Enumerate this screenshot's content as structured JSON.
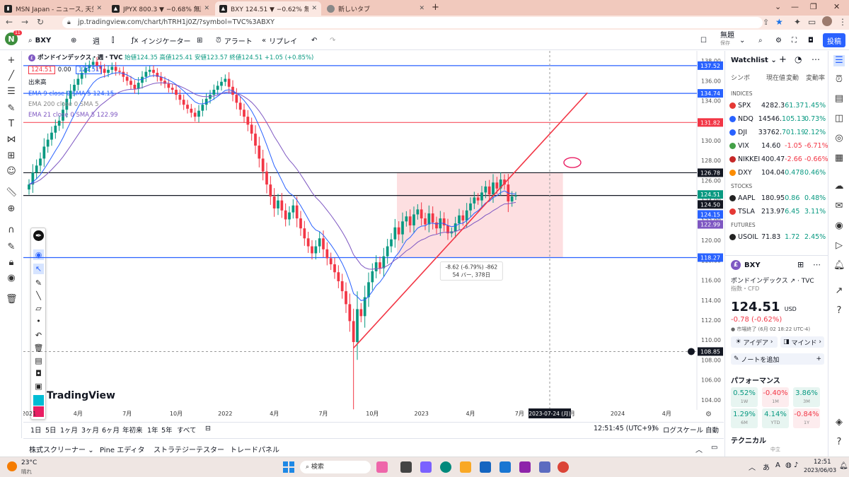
{
  "browser": {
    "tabs": [
      {
        "title": "MSN Japan - ニュース, 天気, メール",
        "color": "#222"
      },
      {
        "title": "JPYX 800.3 ▼ −0.68% 無題",
        "color": "#222"
      },
      {
        "title": "BXY 124.51 ▼ −0.62% 無題",
        "color": "#222",
        "active": true
      },
      {
        "title": "新しいタブ",
        "color": "#666"
      }
    ],
    "url": "jp.tradingview.com/chart/hTRH1j0Z/?symbol=TVC%3ABXY"
  },
  "topbar": {
    "avatar_letter": "N",
    "avatar_badge": "11",
    "symbol": "BXY",
    "interval": "週",
    "indicators": "インジケーター",
    "alerts": "アラート",
    "replay": "リプレイ",
    "layout_name": "無題",
    "layout_sub": "保存",
    "publish": "投稿"
  },
  "legend": {
    "name": "ポンドインデックス・週・TVC",
    "ohlc": "始値124.35 高値125.41 安値123.57 終値124.51 +1.05 (+0.85%)",
    "price_box_1": "124.51",
    "spread": "0.00",
    "price_box_2": "124.51",
    "volume": "出来高",
    "ema9": "EMA 9 close 0 SMA 5  124.15",
    "ema200": "EMA 200 close 0 SMA 5",
    "ema21": "EMA 21 close 0 SMA 5    122.99"
  },
  "chart_data": {
    "type": "candlestick",
    "symbol": "BXY",
    "exchange": "TVC",
    "timeframe": "週",
    "y_ticks": [
      104,
      106,
      108,
      110,
      112,
      114,
      116,
      118,
      120,
      122,
      124,
      126,
      128,
      130,
      132,
      134,
      136,
      138
    ],
    "ylim": [
      103,
      139
    ],
    "x_ticks": [
      "2021",
      "4月",
      "7月",
      "10月",
      "2022",
      "4月",
      "7月",
      "10月",
      "2023",
      "4月",
      "7月",
      "10月",
      "2024",
      "4月"
    ],
    "x_tick_index": [
      0,
      13,
      26,
      39,
      52,
      65,
      78,
      91,
      104,
      117,
      130,
      143,
      156,
      169
    ],
    "x_range": [
      -1.5,
      177
    ],
    "close": [
      125.6,
      126.8,
      127.5,
      128.2,
      129.4,
      130.1,
      130.8,
      131.5,
      132.0,
      133.1,
      134.2,
      135.0,
      135.6,
      136.2,
      136.8,
      137.3,
      137.6,
      137.9,
      137.5,
      137.2,
      136.8,
      137.1,
      137.4,
      137.0,
      136.9,
      136.4,
      136.0,
      135.6,
      135.2,
      135.8,
      136.4,
      136.9,
      137.1,
      136.8,
      136.4,
      136.0,
      135.7,
      135.3,
      135.1,
      134.6,
      134.1,
      133.6,
      133.2,
      132.8,
      132.4,
      133.0,
      133.6,
      134.2,
      134.6,
      135.1,
      135.5,
      135.9,
      136.2,
      135.4,
      134.6,
      133.8,
      133.1,
      132.4,
      131.6,
      130.7,
      129.5,
      128.2,
      126.9,
      125.6,
      124.4,
      123.2,
      124.0,
      123.0,
      122.1,
      122.8,
      123.5,
      122.2,
      121.2,
      120.2,
      119.4,
      118.7,
      119.4,
      120.2,
      119.1,
      118.2,
      117.6,
      116.8,
      115.9,
      114.9,
      113.6,
      111.9,
      109.8,
      113.1,
      112.4,
      114.3,
      115.8,
      116.9,
      117.8,
      117.2,
      118.4,
      119.4,
      120.1,
      121.3,
      120.6,
      121.9,
      122.4,
      121.5,
      122.6,
      123.1,
      122.2,
      121.6,
      122.7,
      121.8,
      121.2,
      122.2,
      121.5,
      120.7,
      120.9,
      121.7,
      122.5,
      122.0,
      123.0,
      123.7,
      124.3,
      124.0,
      124.8,
      125.4,
      124.6,
      125.8,
      125.2,
      126.1,
      125.6,
      123.9,
      124.4,
      124.51
    ],
    "ema_fast_last": 124.15,
    "ema_slow_last": 122.99,
    "horizontal_lines": [
      {
        "price": 137.52,
        "color": "#2962ff"
      },
      {
        "price": 134.74,
        "color": "#2962ff"
      },
      {
        "price": 131.82,
        "color": "#f7525f"
      },
      {
        "price": 126.78,
        "color": "#131722"
      },
      {
        "price": 124.5,
        "color": "#131722"
      },
      {
        "price": 118.27,
        "color": "#2962ff"
      }
    ],
    "price_labels": [
      {
        "text": "137.52",
        "price": 137.52,
        "bg": "#2962ff"
      },
      {
        "text": "134.74",
        "price": 134.74,
        "bg": "#2962ff"
      },
      {
        "text": "131.82",
        "price": 131.82,
        "bg": "#f23645"
      },
      {
        "text": "126.78",
        "price": 126.78,
        "bg": "#131722"
      },
      {
        "text": "124.51",
        "price": 124.6,
        "bg": "#089981"
      },
      {
        "text": "124.50",
        "price": 123.6,
        "bg": "#131722"
      },
      {
        "text": "124.15",
        "price": 122.6,
        "bg": "#2962ff"
      },
      {
        "text": "122.99",
        "price": 121.6,
        "bg": "#7e57c2"
      },
      {
        "text": "118.27",
        "price": 118.27,
        "bg": "#2962ff"
      },
      {
        "text": "108.85",
        "price": 108.85,
        "bg": "#131722"
      }
    ],
    "measure": {
      "line1": "-8.62 (-6.79%) -862",
      "line2": "54 バー, 378日",
      "x_from": 97.5,
      "x_to": 141.5,
      "price_top": 126.78,
      "price_bottom": 118.27
    },
    "trendline": {
      "x1": 86,
      "y1": 109.2,
      "x2": 148,
      "y2": 134.8
    },
    "crosshair": {
      "price": 108.85,
      "date_label": "2023-07-24 (月)",
      "index": 138
    },
    "watermark": "TradingView"
  },
  "rangebar": {
    "ranges": [
      "1日",
      "5日",
      "1ヶ月",
      "3ヶ月",
      "6ヶ月",
      "年初来",
      "1年",
      "5年",
      "すべて"
    ],
    "time": "12:51:45 (UTC+9)",
    "pct": "%",
    "log": "ログスケール",
    "auto": "自動"
  },
  "bottompanel": {
    "tabs": [
      "株式スクリーナー",
      "Pine エディタ",
      "ストラテジーテスター",
      "トレードパネル"
    ]
  },
  "watchlist": {
    "title": "Watchlist",
    "cols": [
      "シンボ",
      "現在値",
      "変動",
      "変動率"
    ],
    "sections": [
      {
        "name": "INDICES",
        "rows": [
          {
            "sym": "SPX",
            "last": "4282.3",
            "chg": "61.37",
            "pct": "1.45%",
            "dir": "pos",
            "color": "#e53935"
          },
          {
            "sym": "NDQ",
            "last": "14546.",
            "chg": "105.13",
            "pct": "0.73%",
            "dir": "pos",
            "color": "#2962ff"
          },
          {
            "sym": "DJI",
            "last": "33762.",
            "chg": "701.19",
            "pct": "2.12%",
            "dir": "pos",
            "color": "#2962ff"
          },
          {
            "sym": "VIX",
            "last": "14.60",
            "chg": "-1.05",
            "pct": "-6.71%",
            "dir": "neg",
            "color": "#43a047"
          },
          {
            "sym": "NIKKEI",
            "last": "400.47",
            "chg": "-2.66",
            "pct": "-0.66%",
            "dir": "neg",
            "color": "#c62828"
          },
          {
            "sym": "DXY",
            "last": "104.04",
            "chg": "0.478",
            "pct": "0.46%",
            "dir": "pos",
            "color": "#fb8c00"
          }
        ]
      },
      {
        "name": "STOCKS",
        "rows": [
          {
            "sym": "AAPL",
            "last": "180.95",
            "chg": "0.86",
            "pct": "0.48%",
            "dir": "pos",
            "color": "#222"
          },
          {
            "sym": "TSLA",
            "last": "213.97",
            "chg": "6.45",
            "pct": "3.11%",
            "dir": "pos",
            "color": "#e53935"
          }
        ]
      },
      {
        "name": "FUTURES",
        "rows": [
          {
            "sym": "USOIL",
            "last": "71.83",
            "chg": "1.72",
            "pct": "2.45%",
            "dir": "pos",
            "color": "#222"
          }
        ]
      }
    ]
  },
  "detail": {
    "symbol": "BXY",
    "name": "ポンドインデックス",
    "exchange": "TVC",
    "type": "指数・CFD",
    "price": "124.51",
    "currency": "USD",
    "change": "-0.78 (-0.62%)",
    "status": "● 市場終了 (6月 02 18:22 UTC-4)",
    "ideas": "アイデア",
    "minds": "マインド",
    "add_note": "ノートを追加",
    "perf_title": "パフォーマンス",
    "perf": [
      {
        "v": "0.52%",
        "l": "1W",
        "dir": "pos"
      },
      {
        "v": "-0.40%",
        "l": "1M",
        "dir": "neg"
      },
      {
        "v": "3.86%",
        "l": "3M",
        "dir": "pos"
      },
      {
        "v": "1.29%",
        "l": "6M",
        "dir": "pos"
      },
      {
        "v": "4.14%",
        "l": "YTD",
        "dir": "pos"
      },
      {
        "v": "-0.84%",
        "l": "1Y",
        "dir": "neg"
      }
    ],
    "tech_title": "テクニカル",
    "tech_sub": "中立"
  },
  "taskbar": {
    "temp": "23°C",
    "weather": "晴れ",
    "search": "検索",
    "lang": "A",
    "time": "12:51",
    "date": "2023/06/03",
    "ime": "あ"
  }
}
